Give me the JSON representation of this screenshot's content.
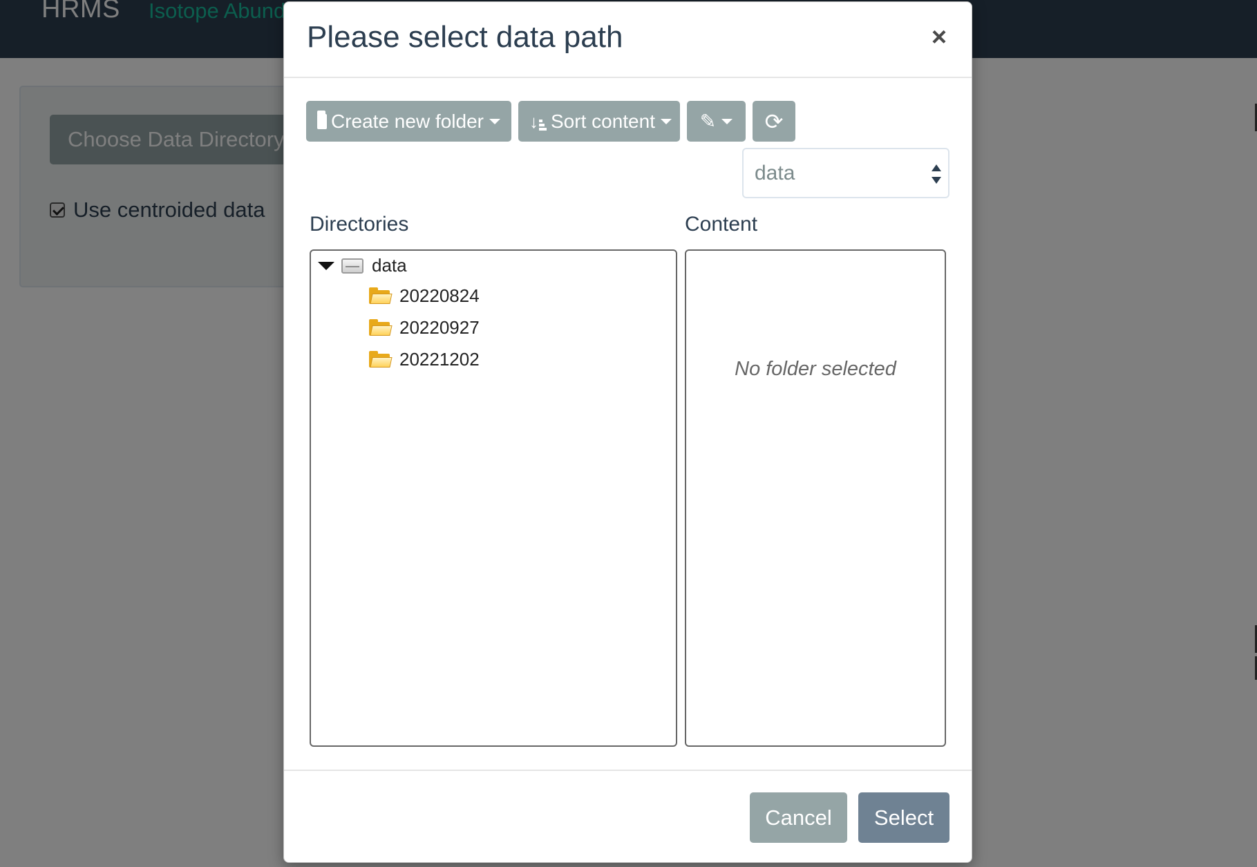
{
  "app": {
    "brand": "HRMS",
    "nav_tab": "Isotope Abund",
    "choose_button": "Choose Data Directory",
    "centroided_label": "Use centroided data"
  },
  "modal": {
    "title": "Please select data path",
    "close_symbol": "×",
    "toolbar": {
      "create_folder": "Create new folder",
      "sort_content": "Sort content"
    },
    "volume_select": {
      "value": "data"
    },
    "directories_label": "Directories",
    "content_label": "Content",
    "tree": {
      "root": "data",
      "children": [
        "20220824",
        "20220927",
        "20221202"
      ]
    },
    "content_empty": "No folder selected",
    "cancel_label": "Cancel",
    "select_label": "Select"
  },
  "colors": {
    "navbar": "#2c3e50",
    "nav_link": "#18bc9c",
    "button_gray": "#95a5a6",
    "select_button": "#6f8293"
  }
}
